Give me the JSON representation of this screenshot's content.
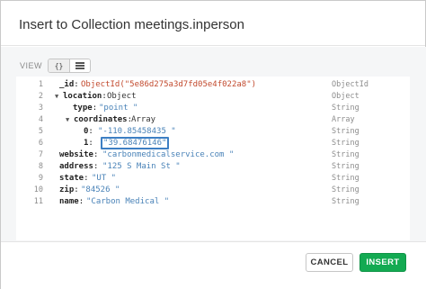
{
  "dialog": {
    "title": "Insert to Collection meetings.inperson",
    "view_label": "VIEW",
    "view_modes": [
      {
        "label": "{}",
        "active": true
      },
      {
        "icon": "list-icon",
        "active": false
      }
    ]
  },
  "document": {
    "lines": [
      {
        "num": "1",
        "key": "_id",
        "value": "ObjectId(\"5e86d275a3d7fd05e4f022a8\")",
        "type": "ObjectId"
      },
      {
        "num": "2",
        "key": "location",
        "value": "Object",
        "type": "Object"
      },
      {
        "num": "3",
        "key": "type",
        "value": "\"point \"",
        "type": "String"
      },
      {
        "num": "4",
        "key": "coordinates",
        "value": "Array",
        "type": "Array"
      },
      {
        "num": "5",
        "key": "0",
        "value": "\"-110.85458435 \"",
        "type": "String"
      },
      {
        "num": "6",
        "key": "1",
        "value": "\"39.68476146\"",
        "type": "String"
      },
      {
        "num": "7",
        "key": "website",
        "value": "\"carbonmedicalservice.com \"",
        "type": "String"
      },
      {
        "num": "8",
        "key": "address",
        "value": "\"125 S Main St \"",
        "type": "String"
      },
      {
        "num": "9",
        "key": "state",
        "value": "\"UT \"",
        "type": "String"
      },
      {
        "num": "10",
        "key": "zip",
        "value": "\"84526 \"",
        "type": "String"
      },
      {
        "num": "11",
        "key": "name",
        "value": "\"Carbon Medical \"",
        "type": "String"
      }
    ]
  },
  "footer": {
    "cancel_label": "CANCEL",
    "insert_label": "INSERT"
  },
  "colors": {
    "insert_green": "#13aa52",
    "objectid_red": "#c24a2e",
    "string_blue": "#4a83b8",
    "focus_blue": "#3d7fc4"
  }
}
